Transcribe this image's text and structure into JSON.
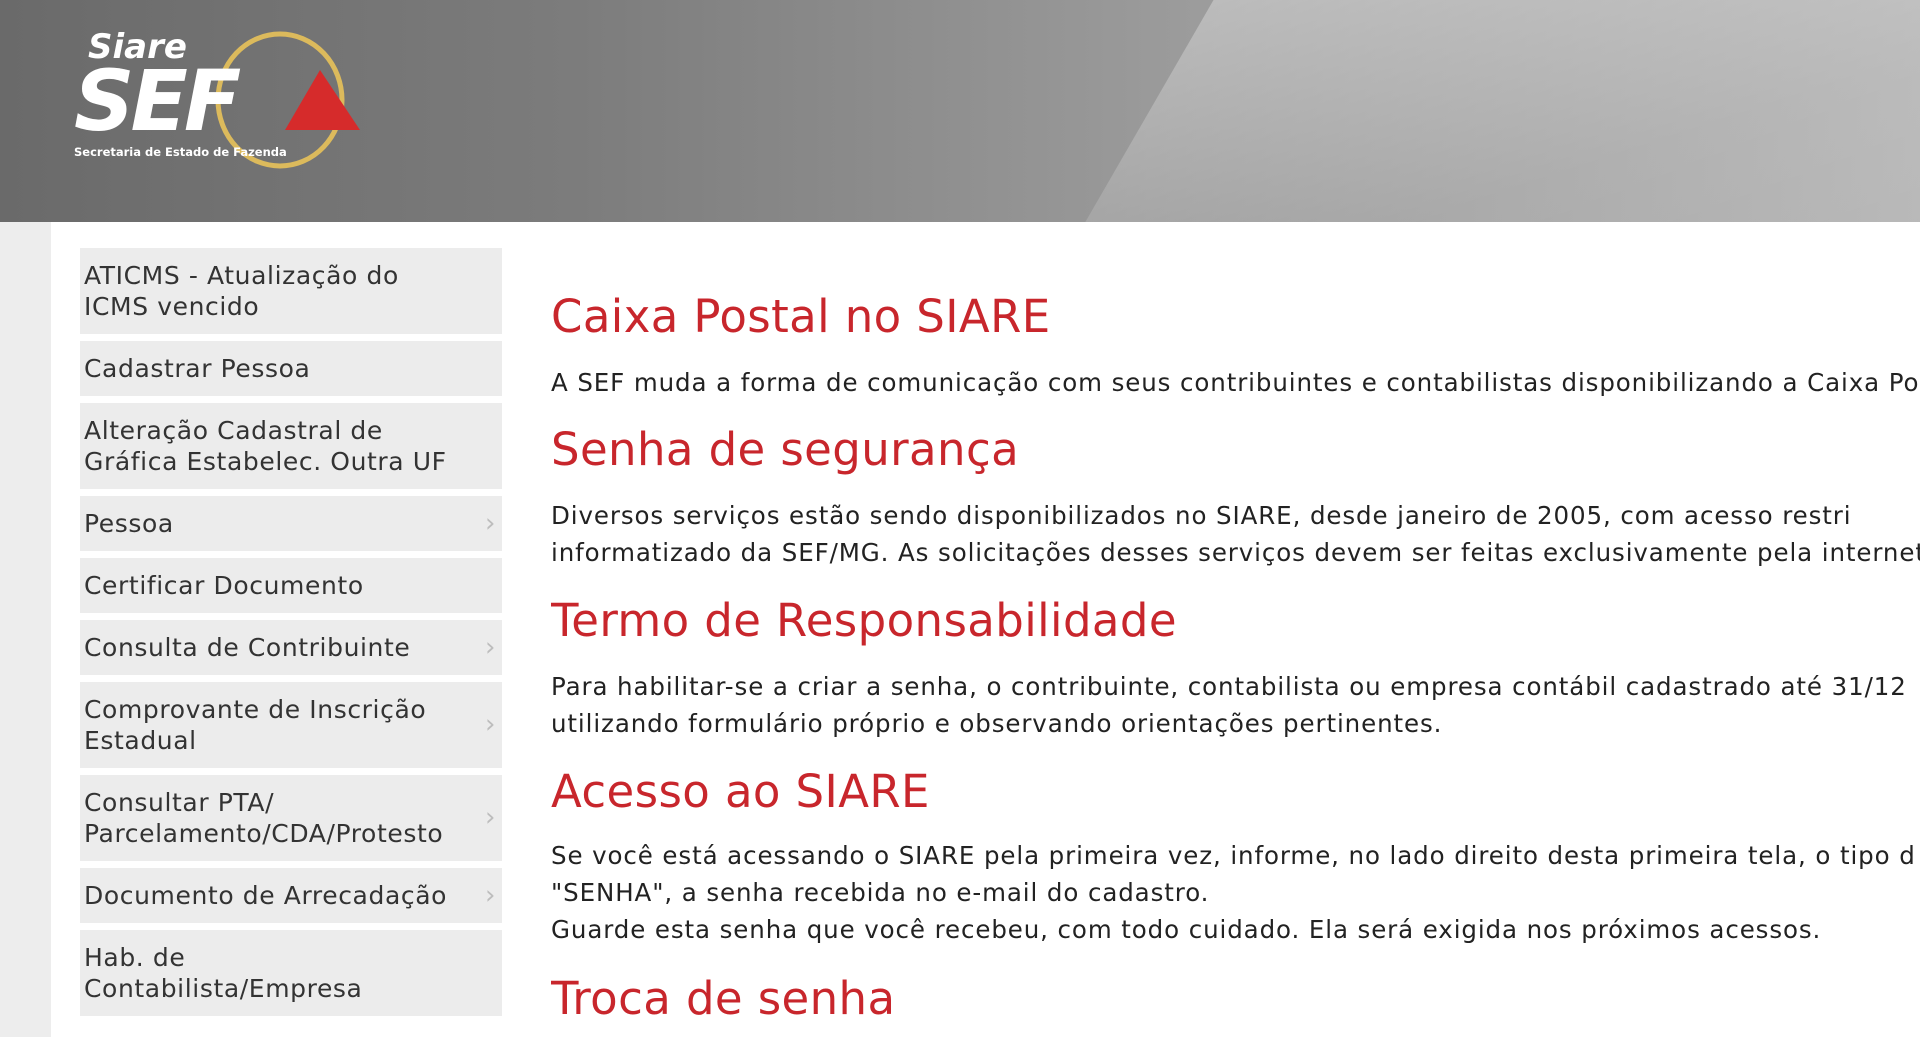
{
  "brand": {
    "logo_small": "Siare",
    "logo_big": "SEF",
    "logo_sub": "Secretaria de Estado de Fazenda",
    "accent_color": "#c8262c"
  },
  "sidebar": {
    "items": [
      {
        "label": "ATICMS - Atualização do ICMS vencido",
        "has_submenu": false
      },
      {
        "label": "Cadastrar Pessoa",
        "has_submenu": false
      },
      {
        "label": "Alteração Cadastral de Gráfica Estabelec. Outra UF",
        "has_submenu": false
      },
      {
        "label": "Pessoa",
        "has_submenu": true
      },
      {
        "label": "Certificar Documento",
        "has_submenu": false
      },
      {
        "label": "Consulta de Contribuinte",
        "has_submenu": true
      },
      {
        "label": "Comprovante de Inscrição Estadual",
        "has_submenu": true
      },
      {
        "label": "Consultar PTA/ Parcelamento/CDA/Protesto",
        "has_submenu": true
      },
      {
        "label": "Documento de Arrecadação",
        "has_submenu": true
      },
      {
        "label": "Hab. de Contabilista/Empresa",
        "has_submenu": false
      }
    ],
    "chevron": "›"
  },
  "main": {
    "sections": [
      {
        "title": "Caixa Postal no SIARE",
        "lines": [
          "A SEF muda a forma de comunicação com seus contribuintes e contabilistas disponibilizando a Caixa Post"
        ]
      },
      {
        "title": "Senha de segurança",
        "lines": [
          "Diversos serviços estão sendo disponibilizados no SIARE, desde janeiro de 2005, com acesso restri",
          "informatizado da SEF/MG. As solicitações desses serviços devem ser feitas exclusivamente pela internet,"
        ]
      },
      {
        "title": "Termo de Responsabilidade",
        "lines": [
          "Para habilitar-se a criar a senha, o contribuinte, contabilista ou empresa contábil cadastrado até 31/12",
          "utilizando formulário próprio e observando orientações pertinentes."
        ]
      },
      {
        "title": "Acesso ao SIARE",
        "lines": [
          "Se você está acessando o SIARE pela primeira vez, informe, no lado direito desta primeira tela, o tipo d",
          "\"SENHA\", a senha recebida no e-mail do cadastro.",
          "Guarde esta senha que você recebeu, com todo cuidado. Ela será exigida nos próximos acessos."
        ]
      },
      {
        "title": "Troca de senha",
        "lines": []
      }
    ]
  }
}
